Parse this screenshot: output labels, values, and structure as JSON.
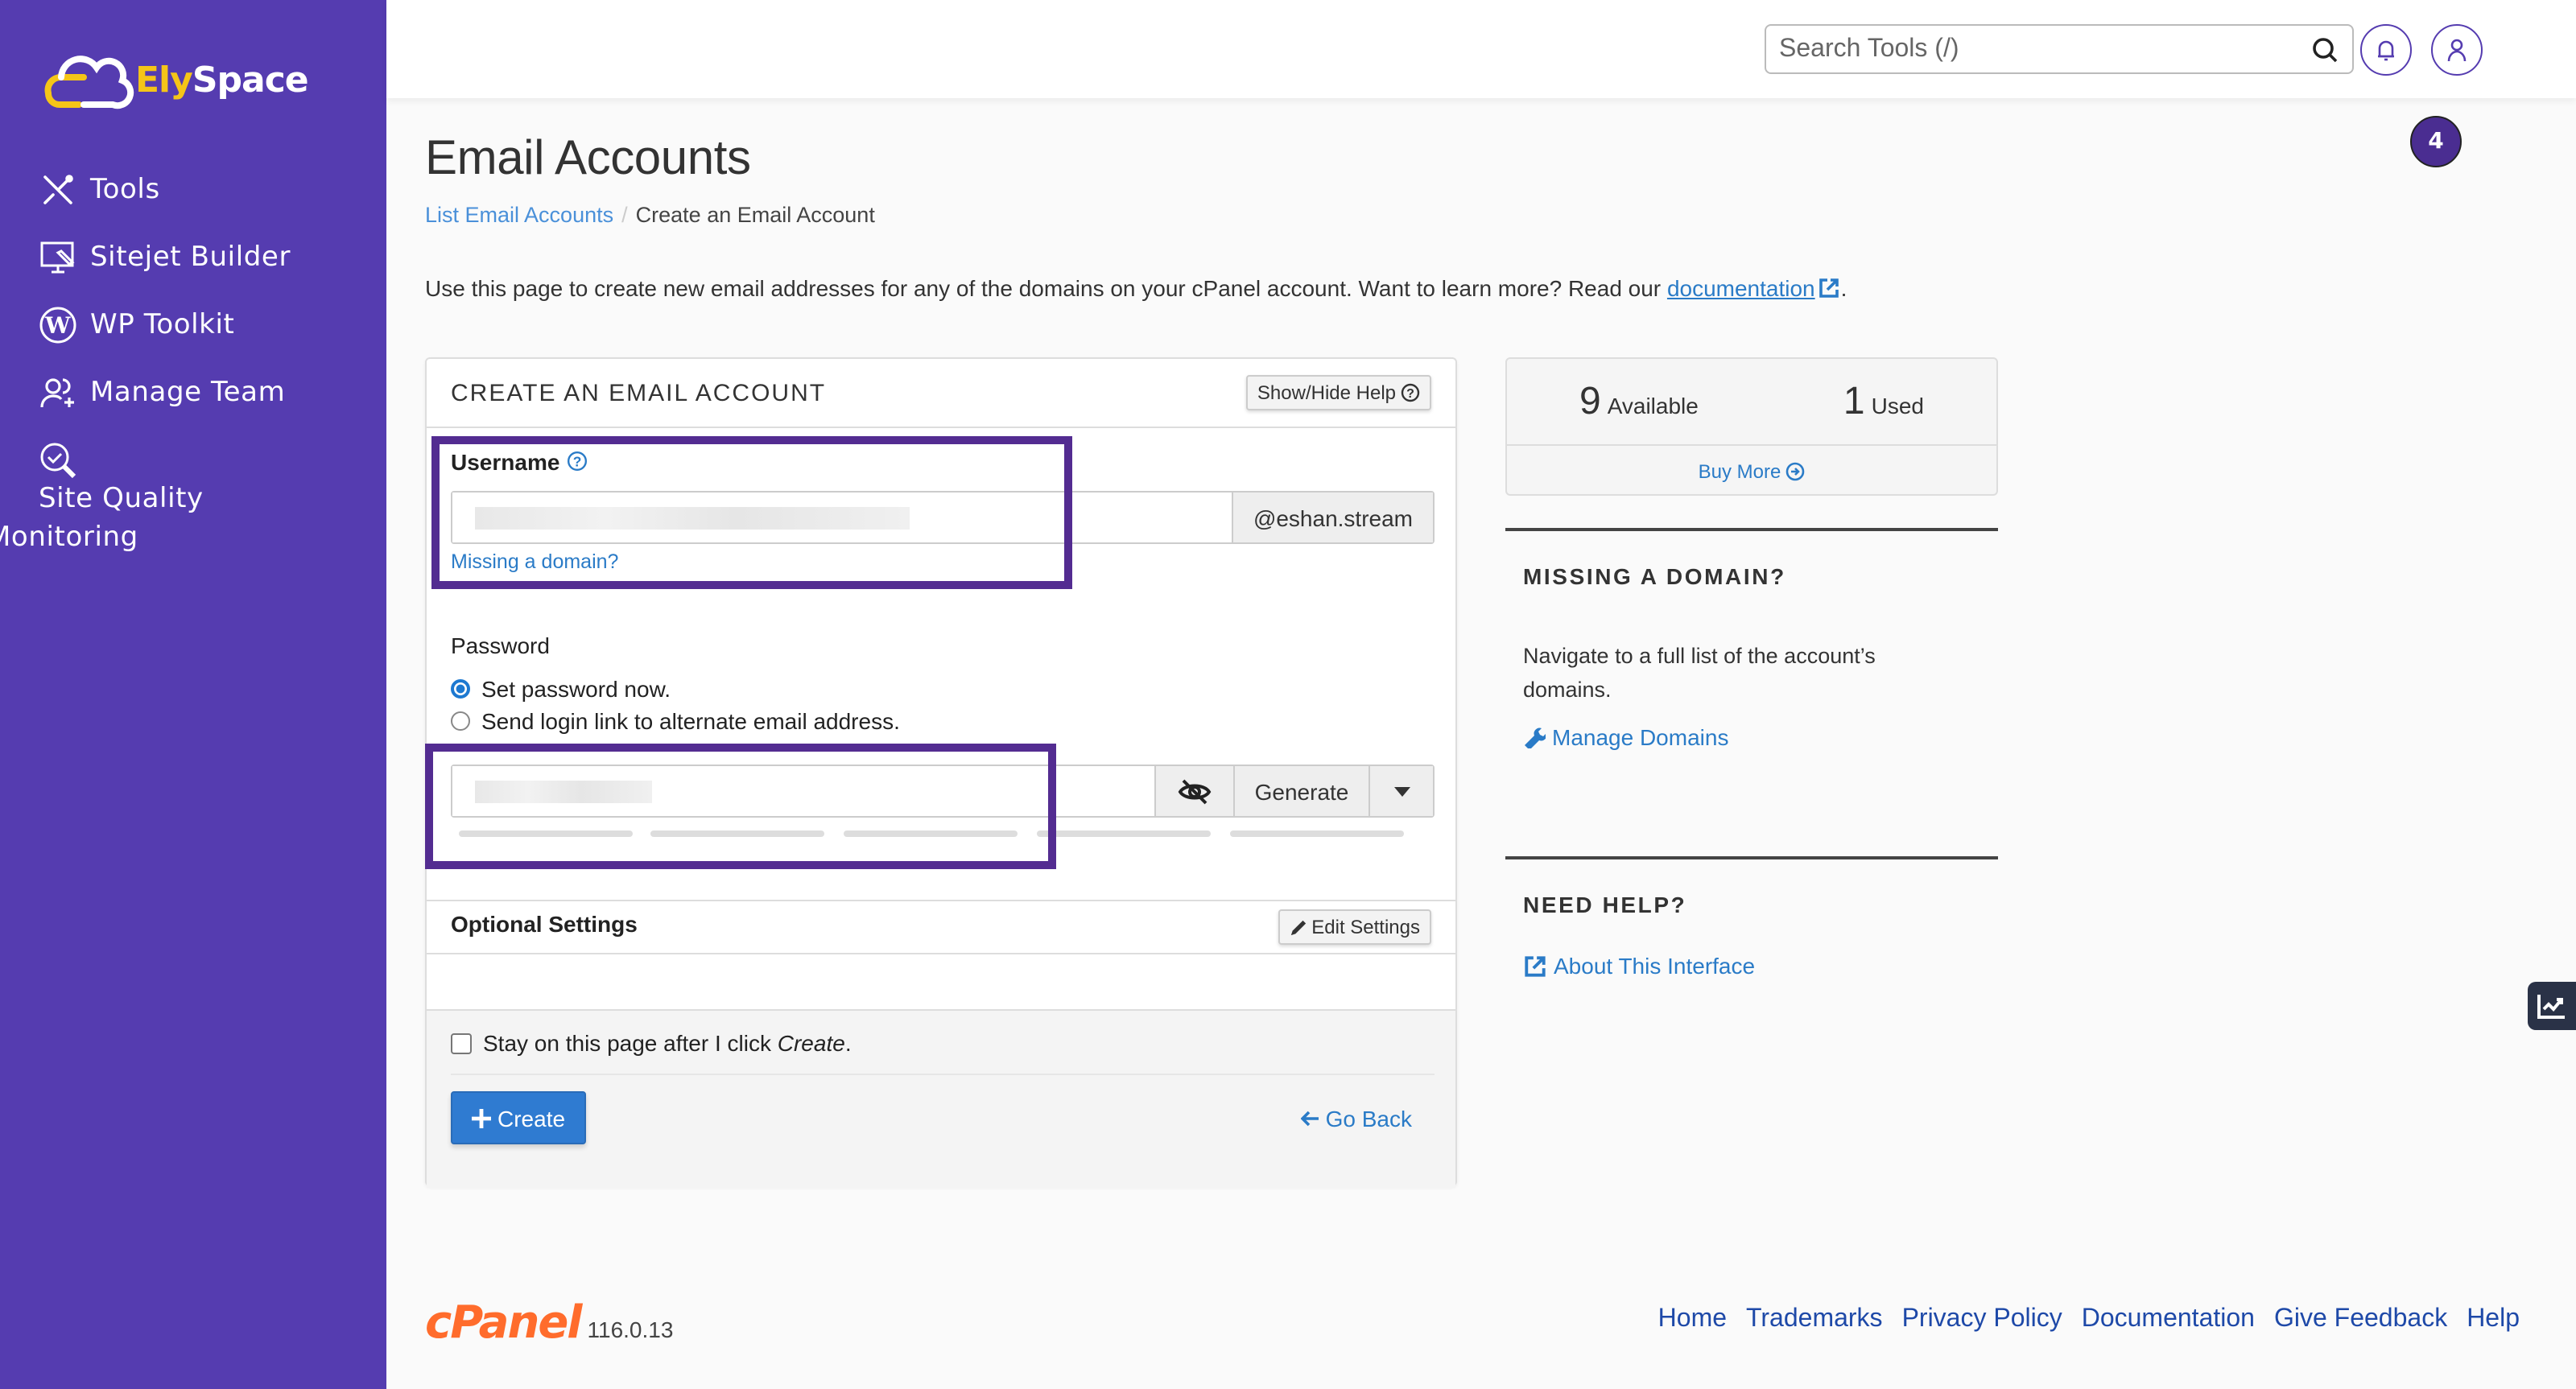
{
  "brand": {
    "name_part1": "Ely",
    "name_part2": "Space",
    "accent": "#f5c518",
    "sidebar_bg": "#553cb0"
  },
  "sidebar": {
    "items": [
      {
        "label": "Tools",
        "icon": "tools-icon"
      },
      {
        "label": "Sitejet Builder",
        "icon": "sitejet-monitor-icon"
      },
      {
        "label": "WP Toolkit",
        "icon": "wordpress-icon"
      },
      {
        "label": "Manage Team",
        "icon": "users-plus-icon"
      },
      {
        "label": "Site Quality Monitoring",
        "icon": "magnify-check-icon"
      }
    ]
  },
  "topbar": {
    "search_placeholder": "Search Tools (/)",
    "notification_count": "4"
  },
  "page": {
    "title": "Email Accounts",
    "breadcrumb": {
      "parent": "List Email Accounts",
      "separator": "/",
      "current": "Create an Email Account"
    },
    "intro_text": "Use this page to create new email addresses for any of the domains on your cPanel account. Want to learn more? Read our ",
    "intro_link": "documentation",
    "intro_end": "."
  },
  "form": {
    "title": "CREATE AN EMAIL ACCOUNT",
    "help_button": "Show/Hide Help",
    "username_label": "Username",
    "username_value": "",
    "domain_suffix": "@eshan.stream",
    "missing_domain_link": "Missing a domain?",
    "password_label": "Password",
    "password_options": [
      {
        "label": "Set password now.",
        "selected": true
      },
      {
        "label": "Send login link to alternate email address.",
        "selected": false
      }
    ],
    "password_value": "",
    "generate_button": "Generate",
    "optional_settings_label": "Optional Settings",
    "edit_settings_button": "Edit Settings",
    "stay_on_page_text": "Stay on this page after I click ",
    "stay_on_page_em": "Create",
    "stay_on_page_end": ".",
    "stay_on_page_checked": false,
    "create_button": "Create",
    "go_back_link": "Go Back"
  },
  "stats": {
    "available_count": "9",
    "available_label": "Available",
    "used_count": "1",
    "used_label": "Used",
    "buy_more": "Buy More"
  },
  "missing_domain": {
    "heading": "MISSING A DOMAIN?",
    "text": "Navigate to a full list of the account’s domains.",
    "link": "Manage Domains"
  },
  "need_help": {
    "heading": "NEED HELP?",
    "link": "About This Interface"
  },
  "footer": {
    "logo": "cPanel",
    "version": "116.0.13",
    "links": [
      "Home",
      "Trademarks",
      "Privacy Policy",
      "Documentation",
      "Give Feedback",
      "Help"
    ]
  }
}
